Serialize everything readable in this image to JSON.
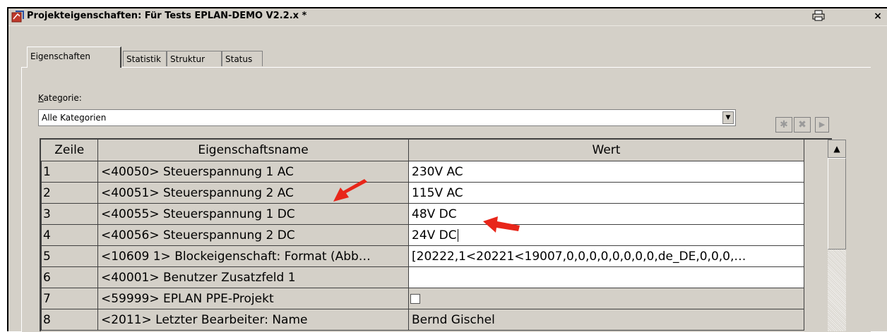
{
  "window": {
    "title": "Projekteigenschaften: Für Tests EPLAN-DEMO V2.2.x *",
    "print_icon": "printer-icon",
    "close_label": "×"
  },
  "tabs": [
    {
      "label": "Eigenschaften",
      "active": true
    },
    {
      "label": "Statistik"
    },
    {
      "label": "Struktur"
    },
    {
      "label": "Status"
    }
  ],
  "kategorie": {
    "label_first": "K",
    "label_rest": "ategorie:",
    "selected": "Alle Kategorien"
  },
  "toolbar": {
    "new_icon": "asterisk-icon",
    "delete_icon": "delete-icon",
    "next_icon": "play-icon"
  },
  "table": {
    "columns": [
      "Zeile",
      "Eigenschaftsname",
      "Wert"
    ],
    "rows": [
      {
        "num": "1",
        "name": "<40050> Steuerspannung 1 AC",
        "value": "230V AC"
      },
      {
        "num": "2",
        "name": "<40051> Steuerspannung 2 AC",
        "value": "115V AC"
      },
      {
        "num": "3",
        "name": "<40055> Steuerspannung 1 DC",
        "value": "48V DC"
      },
      {
        "num": "4",
        "name": "<40056> Steuerspannung 2 DC",
        "value": "24V DC"
      },
      {
        "num": "5",
        "name": "<10609 1> Blockeigenschaft: Format (Abb…",
        "value": "[20222,1<20221<19007,0,0,0,0,0,0,0,0,de_DE,0,0,0,…"
      },
      {
        "num": "6",
        "name": "<40001> Benutzer Zusatzfeld 1",
        "value": ""
      },
      {
        "num": "7",
        "name": "<59999> EPLAN PPE-Projekt",
        "value": ""
      },
      {
        "num": "8",
        "name": "<2011> Letzter Bearbeiter: Name",
        "value": "Bernd Gischel"
      }
    ]
  },
  "colors": {
    "face": "#d4d0c8",
    "arrow": "#e8261a"
  }
}
